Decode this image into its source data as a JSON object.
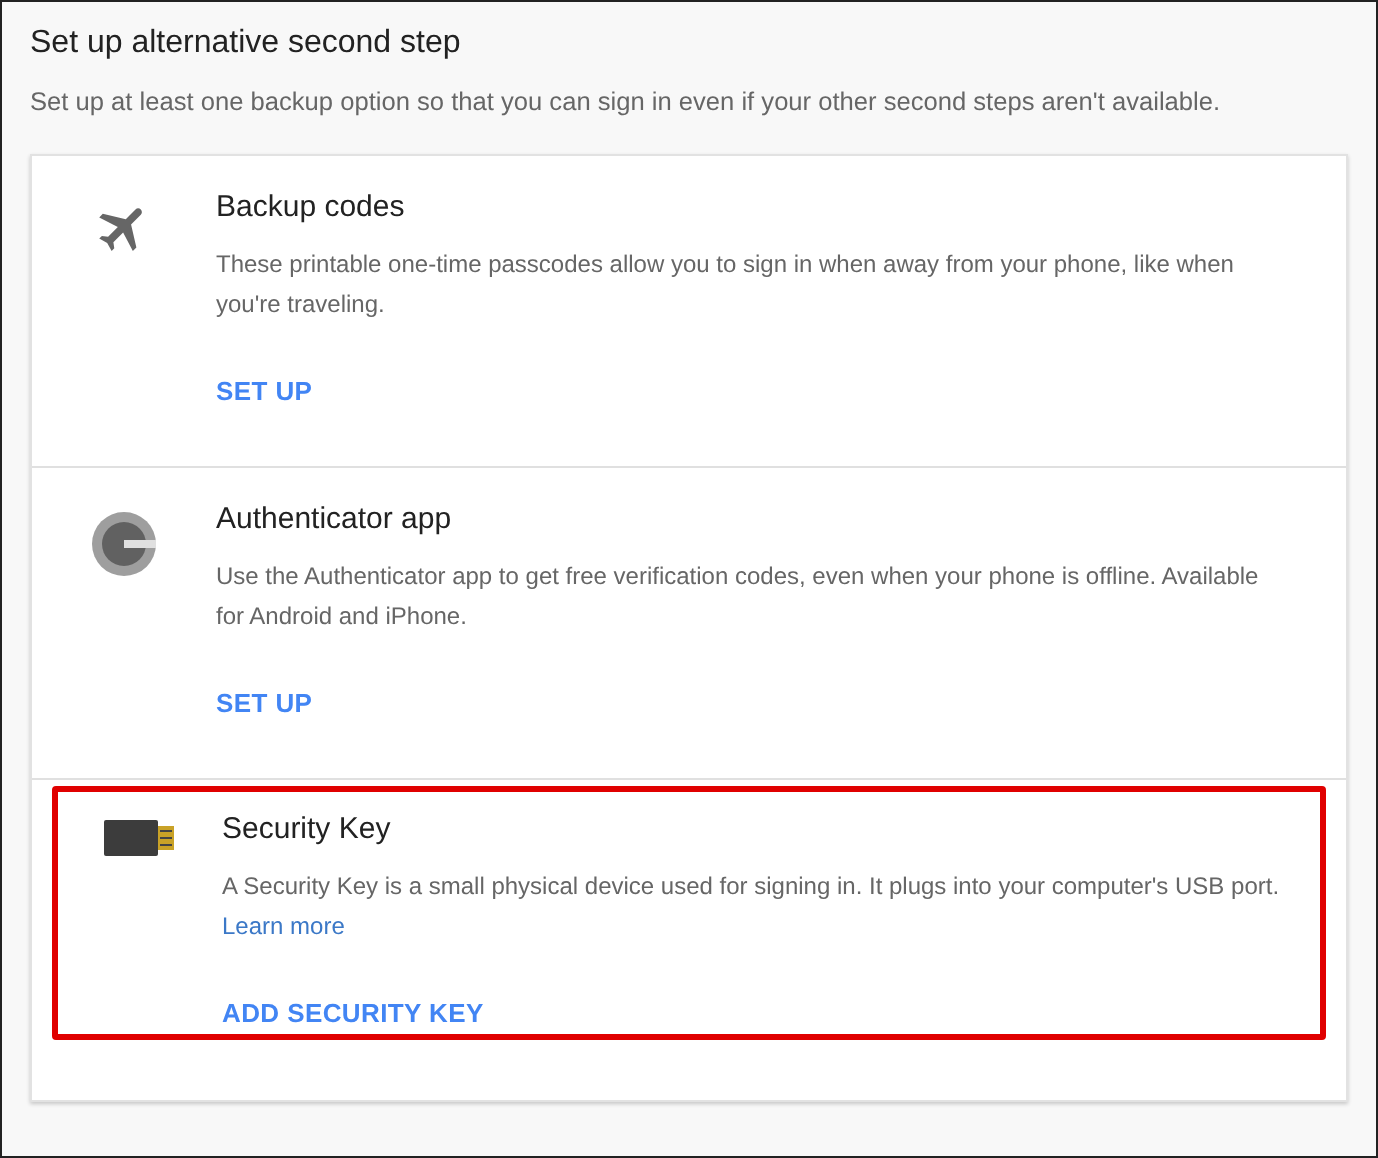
{
  "title": "Set up alternative second step",
  "subtitle": "Set up at least one backup option so that you can sign in even if your other second steps aren't available.",
  "options": [
    {
      "kind": "codes",
      "name": "Backup codes",
      "description": "These printable one-time passcodes allow you to sign in when away from your phone, like when you're traveling.",
      "action": "SET UP",
      "highlighted": false
    },
    {
      "kind": "app",
      "name": "Authenticator app",
      "description": "Use the Authenticator app to get free verification codes, even when your phone is offline. Available for Android and iPhone.",
      "action": "SET UP",
      "highlighted": false
    },
    {
      "kind": "key",
      "name": "Security Key",
      "description": "A Security Key is a small physical device used for signing in. It plugs into your computer's USB port.",
      "link": "Learn more",
      "action": "ADD SECURITY KEY",
      "highlighted": true
    }
  ]
}
